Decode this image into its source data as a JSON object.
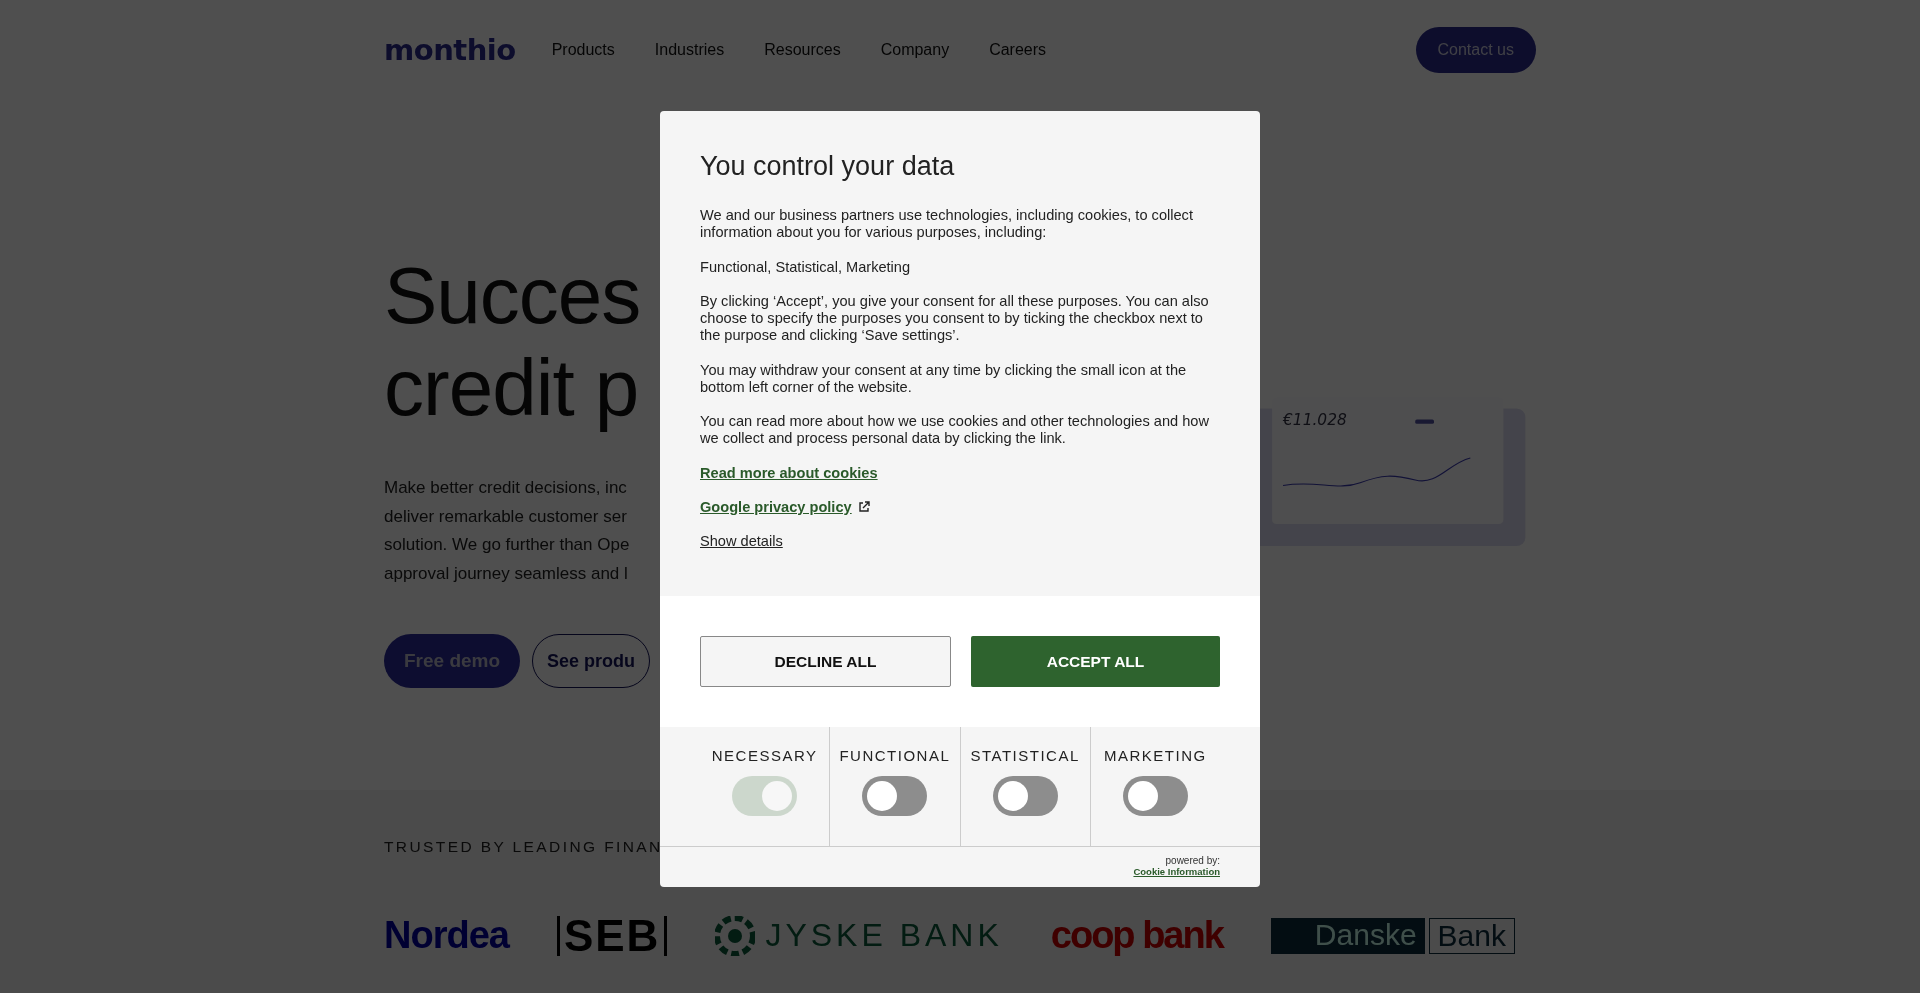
{
  "header": {
    "logo": "monthio",
    "nav": [
      "Products",
      "Industries",
      "Resources",
      "Company",
      "Careers"
    ],
    "contact_button": "Contact us"
  },
  "hero": {
    "title_lines": [
      "Succes",
      "credit p"
    ],
    "paragraph_lines": [
      "Make better credit decisions, inc",
      "deliver remarkable customer ser",
      "solution. We go further than Ope",
      "approval journey seamless and l"
    ],
    "buttons": [
      {
        "label": "Free demo",
        "kind": "primary"
      },
      {
        "label": "See produ",
        "kind": "outline"
      }
    ],
    "illustration": {
      "amount": "€11.028"
    }
  },
  "trusted": {
    "heading": "TRUSTED BY LEADING FINAN",
    "logos": [
      {
        "name": "Nordea",
        "kind": "nordea"
      },
      {
        "name": "SEB",
        "kind": "seb"
      },
      {
        "name": "JYSKE BANK",
        "kind": "jyske"
      },
      {
        "name": "coop bank",
        "kind": "coop"
      },
      {
        "name": "Danske",
        "name2": "Bank",
        "kind": "danske"
      }
    ]
  },
  "cookie_dialog": {
    "title": "You control your data",
    "paragraphs": [
      "We and our business partners use technologies, including cookies, to collect information about you for various purposes, including:",
      "Functional, Statistical, Marketing",
      "By clicking ‘Accept’, you give your consent for all these purposes. You can also choose to specify the purposes you consent to by ticking the checkbox next to the purpose and clicking ‘Save settings’.",
      "You may withdraw your consent at any time by clicking the small icon at the bottom left corner of the website.",
      "You can read more about how we use cookies and other technologies and how we collect and process personal data by clicking the link."
    ],
    "links": [
      {
        "label": "Read more about cookies",
        "kind": "strong",
        "external": false
      },
      {
        "label": "Google privacy policy",
        "kind": "strong",
        "external": true
      },
      {
        "label": "Show details",
        "kind": "plain",
        "external": false
      }
    ],
    "decline_button": "DECLINE ALL",
    "accept_button": "ACCEPT ALL",
    "categories": [
      {
        "label": "NECESSARY",
        "checked": true,
        "disabled": true
      },
      {
        "label": "FUNCTIONAL",
        "checked": false,
        "disabled": false
      },
      {
        "label": "STATISTICAL",
        "checked": false,
        "disabled": false
      },
      {
        "label": "MARKETING",
        "checked": false,
        "disabled": false
      }
    ],
    "powered_by": "powered by:",
    "provider_link": "Cookie Information"
  }
}
